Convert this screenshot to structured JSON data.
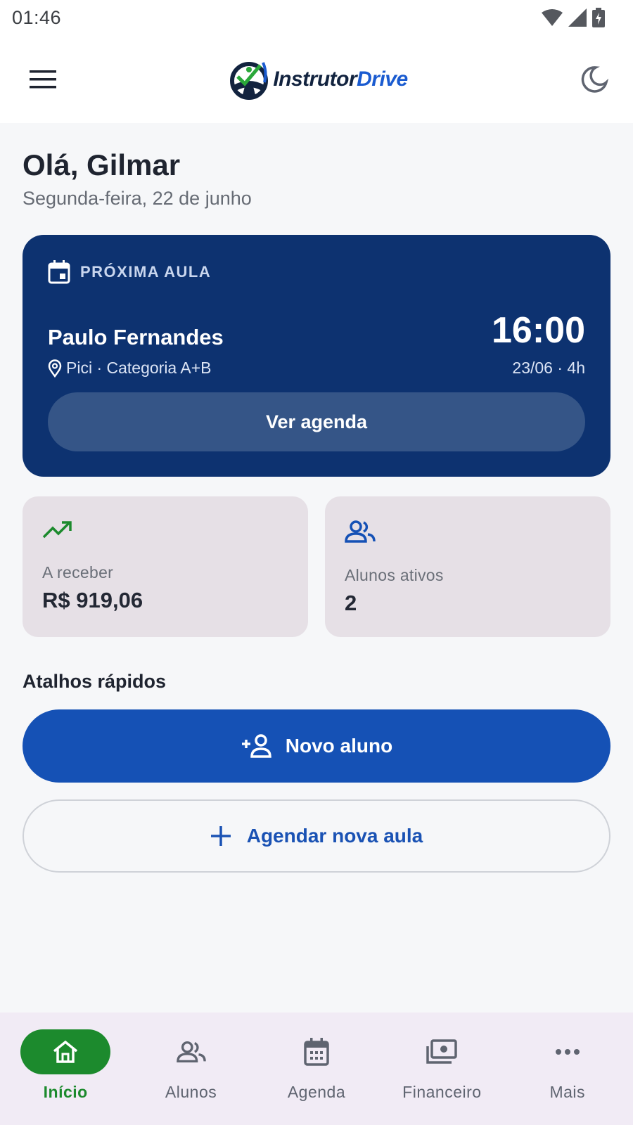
{
  "status_bar": {
    "time": "01:46",
    "icons": [
      "wifi-icon",
      "signal-icon",
      "battery-charging-icon"
    ]
  },
  "app_bar": {
    "menu_icon": "menu-icon",
    "logo_part1": "Instrutor",
    "logo_part2": "Drive",
    "theme_icon": "moon-icon"
  },
  "greeting": {
    "title": "Olá, Gilmar",
    "date": "Segunda-feira, 22 de junho"
  },
  "next_lesson": {
    "label": "PRÓXIMA AULA",
    "student": "Paulo Fernandes",
    "location": "Pici · Categoria A+B",
    "time": "16:00",
    "date_duration": "23/06 · 4h",
    "button": "Ver agenda"
  },
  "stats": [
    {
      "icon": "trending-up-icon",
      "label": "A receber",
      "value": "R$ 919,06"
    },
    {
      "icon": "people-icon",
      "label": "Alunos ativos",
      "value": "2"
    }
  ],
  "shortcuts": {
    "title": "Atalhos rápidos",
    "new_student": "Novo aluno",
    "schedule_lesson": "Agendar nova aula"
  },
  "nav": [
    {
      "label": "Início",
      "icon": "home-icon",
      "active": true
    },
    {
      "label": "Alunos",
      "icon": "people-icon",
      "active": false
    },
    {
      "label": "Agenda",
      "icon": "calendar-icon",
      "active": false
    },
    {
      "label": "Financeiro",
      "icon": "money-icon",
      "active": false
    },
    {
      "label": "Mais",
      "icon": "more-icon",
      "active": false
    }
  ],
  "colors": {
    "primary": "#1551b5",
    "card_dark": "#0d3270",
    "success": "#1c8a2d",
    "stat_bg": "#e6e0e6"
  }
}
